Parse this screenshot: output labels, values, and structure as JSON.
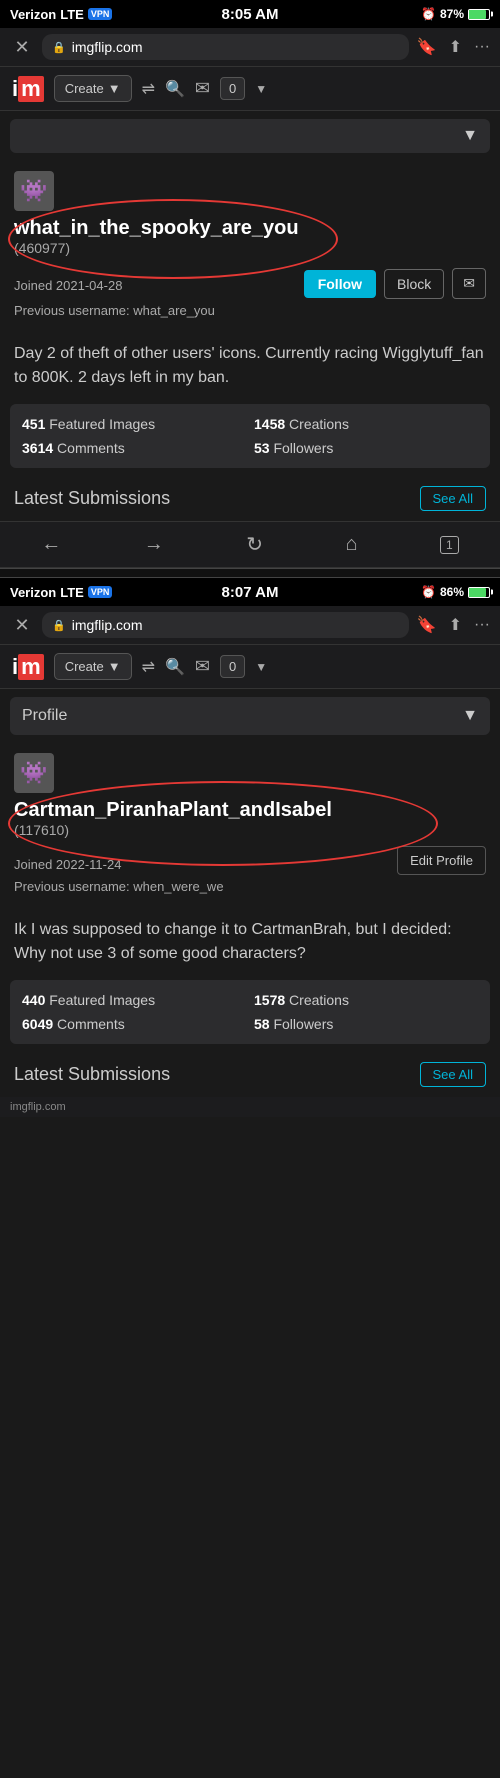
{
  "screenshot1": {
    "statusBar": {
      "carrier": "Verizon",
      "network": "LTE",
      "vpn": "VPN",
      "time": "8:05 AM",
      "battery": "87%"
    },
    "browser": {
      "url": "imgflip.com",
      "closeLabel": "✕",
      "bookmarkIcon": "⊟",
      "shareIcon": "⬆",
      "moreIcon": "···"
    },
    "header": {
      "createLabel": "Create",
      "notifCount": "0"
    },
    "profile": {
      "avatar": "👾",
      "username": "what_in_the_spooky_are_you",
      "userId": "(460977)",
      "joinDate": "Joined 2021-04-28",
      "previousUsername": "Previous username: what_are_you",
      "followLabel": "Follow",
      "blockLabel": "Block",
      "bio": "Day 2 of theft of other users' icons. Currently racing Wigglytuff_fan to 800K. 2 days left in my ban.",
      "stats": [
        {
          "label": "Featured Images",
          "value": "451"
        },
        {
          "label": "Creations",
          "value": "1458"
        },
        {
          "label": "Comments",
          "value": "3614"
        },
        {
          "label": "Followers",
          "value": "53"
        }
      ],
      "latestSubmissions": "Latest Submissions",
      "seeAllLabel": "See All"
    }
  },
  "screenshot2": {
    "statusBar": {
      "carrier": "Verizon",
      "network": "LTE",
      "vpn": "VPN",
      "time": "8:07 AM",
      "battery": "86%"
    },
    "browser": {
      "url": "imgflip.com",
      "closeLabel": "✕",
      "bookmarkIcon": "⊟",
      "shareIcon": "⬆",
      "moreIcon": "···"
    },
    "header": {
      "createLabel": "Create",
      "notifCount": "0"
    },
    "profileDropdown": {
      "label": "Profile",
      "arrowIcon": "▼"
    },
    "profile": {
      "avatar": "👾",
      "username": "Cartman_PiranhaPlant_andIsabel",
      "userId": "(117610)",
      "joinDate": "Joined 2022-11-24",
      "previousUsername": "Previous username: when_were_we",
      "editProfileLabel": "Edit Profile",
      "bio": "Ik I was supposed to change it to CartmanBrah, but I decided: Why not use 3 of some good characters?",
      "stats": [
        {
          "label": "Featured Images",
          "value": "440"
        },
        {
          "label": "Creations",
          "value": "1578"
        },
        {
          "label": "Comments",
          "value": "6049"
        },
        {
          "label": "Followers",
          "value": "58"
        }
      ],
      "latestSubmissions": "Latest Submissions",
      "seeAllLabel": "See All"
    }
  },
  "bottomBar": {
    "url": "imgflip.com"
  }
}
